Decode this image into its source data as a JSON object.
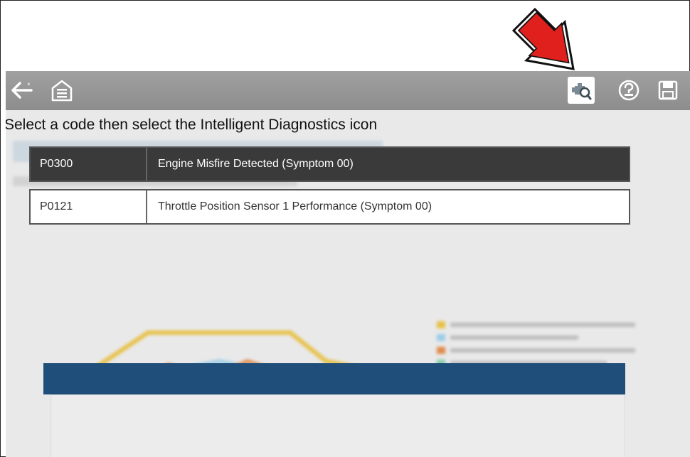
{
  "toolbar": {
    "back_icon": "back-arrow-icon",
    "home_icon": "home-icon",
    "intelligent_diagnostics_icon": "engine-search-icon",
    "help_icon": "help-icon",
    "save_icon": "save-icon"
  },
  "instruction": "Select a code then select the Intelligent Diagnostics icon",
  "codes": [
    {
      "code": "P0300",
      "description": "Engine Misfire Detected (Symptom 00)",
      "selected": true
    },
    {
      "code": "P0121",
      "description": "Throttle Position Sensor 1 Performance (Symptom 00)",
      "selected": false
    }
  ],
  "colors": {
    "toolbar": "#999999",
    "selected_row": "#3a3a3a",
    "callout_arrow": "#e0201c",
    "tsb_header": "#1f4e7a"
  }
}
